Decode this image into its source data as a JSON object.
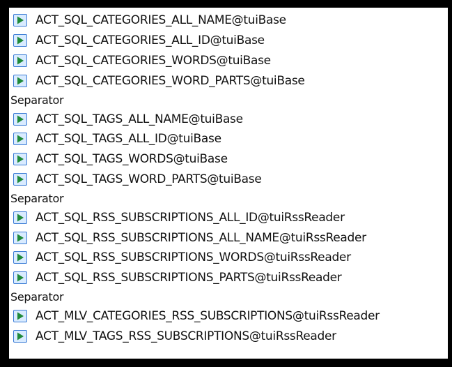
{
  "colors": {
    "icon_fill": "#1f8a3a",
    "icon_border": "#3a7bd5",
    "icon_bg": "#d9ebff",
    "frame": "#000000"
  },
  "list": {
    "items": [
      {
        "kind": "action",
        "label": "ACT_SQL_CATEGORIES_ALL_NAME@tuiBase",
        "icon": "run-action-icon"
      },
      {
        "kind": "action",
        "label": "ACT_SQL_CATEGORIES_ALL_ID@tuiBase",
        "icon": "run-action-icon"
      },
      {
        "kind": "action",
        "label": "ACT_SQL_CATEGORIES_WORDS@tuiBase",
        "icon": "run-action-icon"
      },
      {
        "kind": "action",
        "label": "ACT_SQL_CATEGORIES_WORD_PARTS@tuiBase",
        "icon": "run-action-icon"
      },
      {
        "kind": "separator",
        "label": "Separator"
      },
      {
        "kind": "action",
        "label": "ACT_SQL_TAGS_ALL_NAME@tuiBase",
        "icon": "run-action-icon"
      },
      {
        "kind": "action",
        "label": "ACT_SQL_TAGS_ALL_ID@tuiBase",
        "icon": "run-action-icon"
      },
      {
        "kind": "action",
        "label": "ACT_SQL_TAGS_WORDS@tuiBase",
        "icon": "run-action-icon"
      },
      {
        "kind": "action",
        "label": "ACT_SQL_TAGS_WORD_PARTS@tuiBase",
        "icon": "run-action-icon"
      },
      {
        "kind": "separator",
        "label": "Separator"
      },
      {
        "kind": "action",
        "label": "ACT_SQL_RSS_SUBSCRIPTIONS_ALL_ID@tuiRssReader",
        "icon": "run-action-icon"
      },
      {
        "kind": "action",
        "label": "ACT_SQL_RSS_SUBSCRIPTIONS_ALL_NAME@tuiRssReader",
        "icon": "run-action-icon"
      },
      {
        "kind": "action",
        "label": "ACT_SQL_RSS_SUBSCRIPTIONS_WORDS@tuiRssReader",
        "icon": "run-action-icon"
      },
      {
        "kind": "action",
        "label": "ACT_SQL_RSS_SUBSCRIPTIONS_PARTS@tuiRssReader",
        "icon": "run-action-icon"
      },
      {
        "kind": "separator",
        "label": "Separator"
      },
      {
        "kind": "action",
        "label": "ACT_MLV_CATEGORIES_RSS_SUBSCRIPTIONS@tuiRssReader",
        "icon": "run-action-icon"
      },
      {
        "kind": "action",
        "label": "ACT_MLV_TAGS_RSS_SUBSCRIPTIONS@tuiRssReader",
        "icon": "run-action-icon"
      }
    ]
  }
}
